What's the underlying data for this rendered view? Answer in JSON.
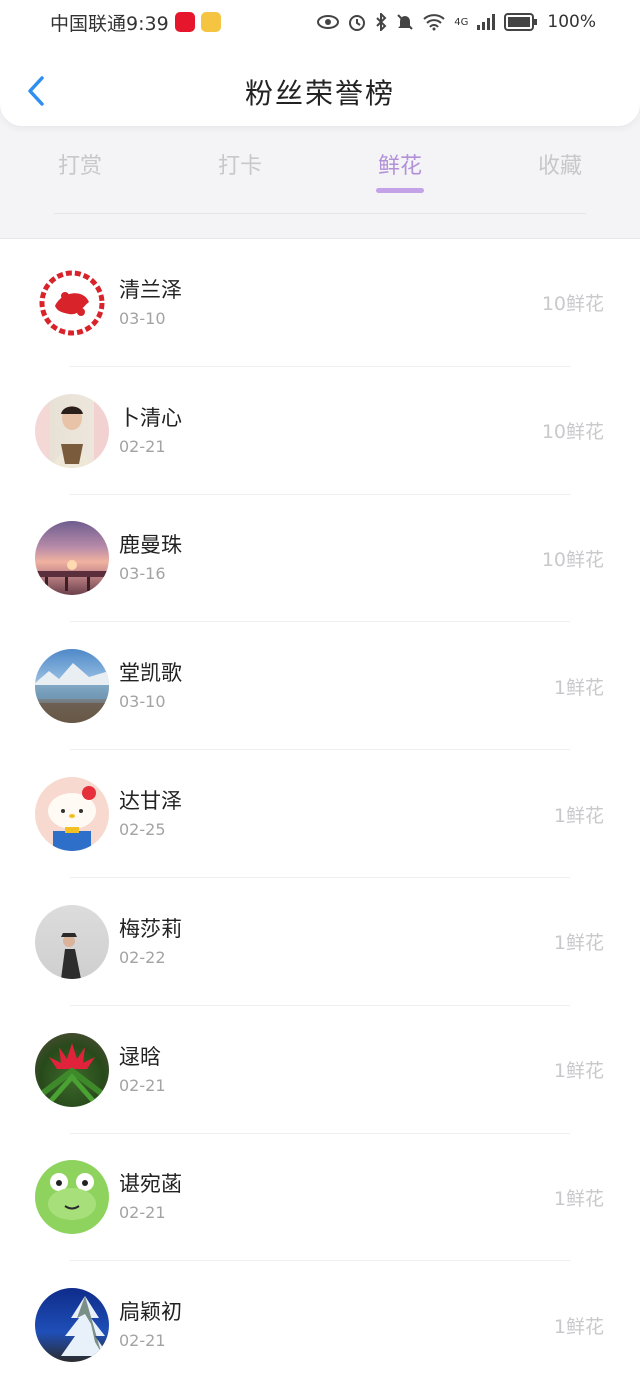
{
  "status_bar": {
    "carrier_time": "中国联通9:39",
    "battery": "100%",
    "network": "4G"
  },
  "header": {
    "title": "粉丝荣誉榜",
    "back_icon": "chevron-left-icon"
  },
  "tabs": [
    {
      "label": "打赏",
      "active": false
    },
    {
      "label": "打卡",
      "active": false
    },
    {
      "label": "鲜花",
      "active": true
    },
    {
      "label": "收藏",
      "active": false
    }
  ],
  "accent_color": "#b291d9",
  "list": [
    {
      "name": "清兰泽",
      "date": "03-10",
      "amount": "10鲜花",
      "avatar": "paper-cut-avatar"
    },
    {
      "name": "卜清心",
      "date": "02-21",
      "amount": "10鲜花",
      "avatar": "woman-photo-avatar"
    },
    {
      "name": "鹿曼珠",
      "date": "03-16",
      "amount": "10鲜花",
      "avatar": "sunset-pier-avatar"
    },
    {
      "name": "堂凯歌",
      "date": "03-10",
      "amount": "1鲜花",
      "avatar": "mountain-lake-avatar"
    },
    {
      "name": "达甘泽",
      "date": "02-25",
      "amount": "1鲜花",
      "avatar": "hello-kitty-avatar"
    },
    {
      "name": "梅莎莉",
      "date": "02-22",
      "amount": "1鲜花",
      "avatar": "person-wall-avatar"
    },
    {
      "name": "逯晗",
      "date": "02-21",
      "amount": "1鲜花",
      "avatar": "red-flower-avatar"
    },
    {
      "name": "谌宛菡",
      "date": "02-21",
      "amount": "1鲜花",
      "avatar": "green-frog-avatar"
    },
    {
      "name": "扃颖初",
      "date": "02-21",
      "amount": "1鲜花",
      "avatar": "snowy-tree-avatar"
    }
  ]
}
